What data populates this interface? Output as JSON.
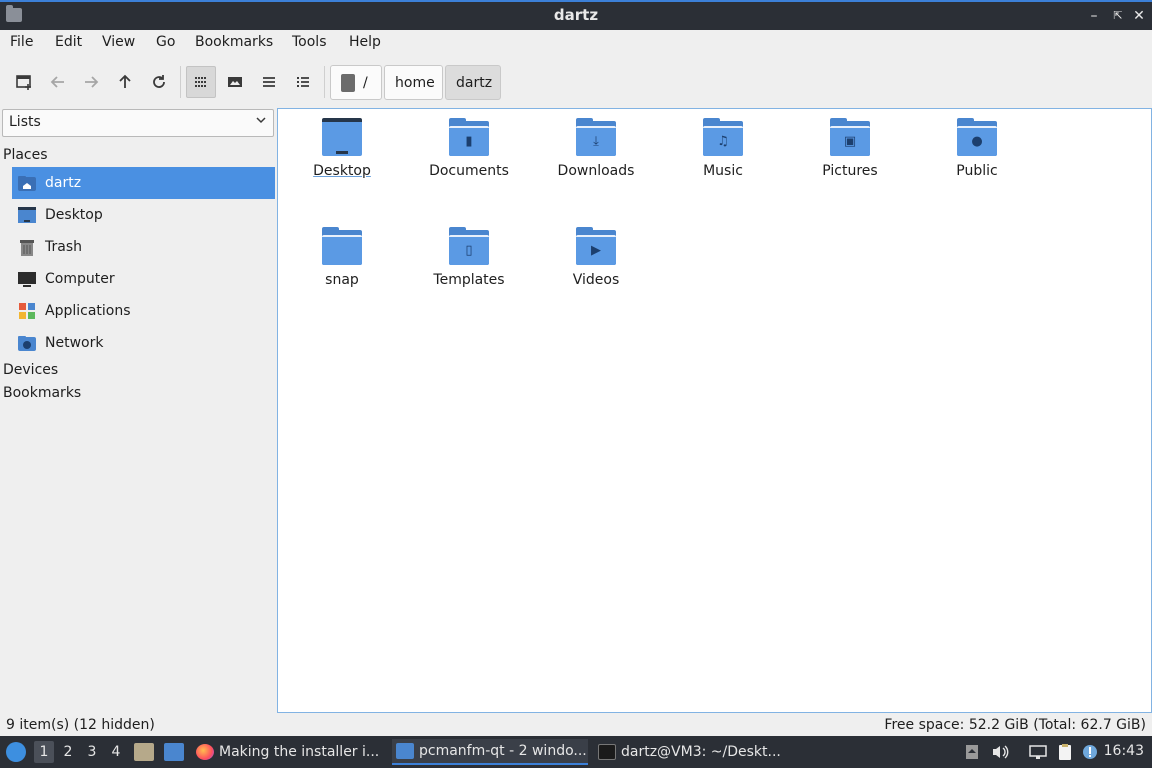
{
  "window": {
    "title": "dartz"
  },
  "menu": [
    "File",
    "Edit",
    "View",
    "Go",
    "Bookmarks",
    "Tools",
    "Help"
  ],
  "toolbar": {
    "buttons": [
      "new-tab",
      "back",
      "forward",
      "up",
      "reload",
      "icon-view",
      "thumbnail-view",
      "compact-view",
      "detailed-list-view"
    ],
    "breadcrumb": [
      "/",
      "home",
      "dartz"
    ]
  },
  "sidepane": {
    "view_mode": "Lists",
    "sections": {
      "places": "Places",
      "devices": "Devices",
      "bookmarks": "Bookmarks"
    },
    "places": [
      {
        "label": "dartz",
        "icon": "home-folder-icon",
        "selected": true
      },
      {
        "label": "Desktop",
        "icon": "desktop-icon",
        "selected": false
      },
      {
        "label": "Trash",
        "icon": "trash-icon",
        "selected": false
      },
      {
        "label": "Computer",
        "icon": "computer-icon",
        "selected": false
      },
      {
        "label": "Applications",
        "icon": "applications-icon",
        "selected": false
      },
      {
        "label": "Network",
        "icon": "network-icon",
        "selected": false
      }
    ]
  },
  "files": [
    {
      "name": "Desktop",
      "icon": "desktop-folder-icon"
    },
    {
      "name": "Documents",
      "icon": "documents-folder-icon"
    },
    {
      "name": "Downloads",
      "icon": "downloads-folder-icon"
    },
    {
      "name": "Music",
      "icon": "music-folder-icon"
    },
    {
      "name": "Pictures",
      "icon": "pictures-folder-icon"
    },
    {
      "name": "Public",
      "icon": "public-folder-icon"
    },
    {
      "name": "snap",
      "icon": "folder-icon"
    },
    {
      "name": "Templates",
      "icon": "templates-folder-icon"
    },
    {
      "name": "Videos",
      "icon": "videos-folder-icon"
    }
  ],
  "status": {
    "items": "9 item(s) (12 hidden)",
    "free_space": "Free space: 52.2 GiB (Total: 62.7 GiB)"
  },
  "taskbar": {
    "workspaces": [
      "1",
      "2",
      "3",
      "4"
    ],
    "active_workspace": "1",
    "tasks": [
      {
        "label": "Making the installer i...",
        "icon": "firefox-icon"
      },
      {
        "label": "pcmanfm-qt - 2 windo...",
        "icon": "folder-icon"
      },
      {
        "label": "dartz@VM3: ~/Deskt...",
        "icon": "terminal-icon"
      }
    ],
    "clock": "16:43"
  },
  "colors": {
    "accent": "#4a90e2",
    "folder": "#5b9ae4",
    "panel": "#2b2f36"
  }
}
